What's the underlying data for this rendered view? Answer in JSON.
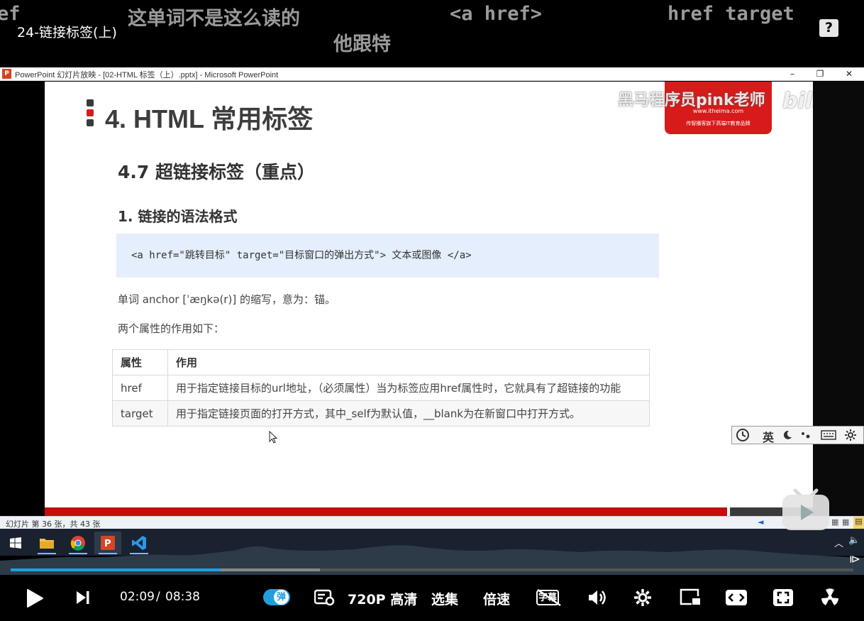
{
  "player": {
    "video_title": "24-链接标签(上)",
    "danmaku": [
      "ef",
      "这单词不是这么读的",
      "<a href>",
      "href target",
      "他跟特"
    ],
    "help_label": "?",
    "time_current": "02:09",
    "time_separator": "/",
    "time_total": "08:38",
    "danmaku_toggle_label": "弹",
    "quality_label": "720P 高清",
    "episodes_label": "选集",
    "speed_label": "倍速",
    "subtitle_label": "字幕",
    "progress_played": 0.249,
    "progress_buffered": 0.367,
    "accent_color": "#1f9fe0"
  },
  "ppt": {
    "window_title": "PowerPoint 幻灯片放映 - [02-HTML 标签（上）.pptx] - Microsoft PowerPoint",
    "icon_letter": "P",
    "status_slide_count": "幻灯片 第 36 张，共 43 张"
  },
  "slide": {
    "heading": "4. HTML 常用标签",
    "logo_url": "www.itheima.com",
    "logo_slogan": "传智播客旗下高端IT教育品牌",
    "watermark": "黑马程序员pink老师",
    "bili_logo": "bilibili",
    "sub_heading": "4.7 超链接标签（重点）",
    "section_heading": "1. 链接的语法格式",
    "code_line": "<a href=\"跳转目标\" target=\"目标窗口的弹出方式\"> 文本或图像 </a>",
    "anchor_text": "单词 anchor [ˈæŋkə(r)] 的缩写，意为：锚。",
    "attrs_text": "两个属性的作用如下：",
    "table": {
      "headers": [
        "属性",
        "作用"
      ],
      "rows": [
        [
          "href",
          "用于指定链接目标的url地址，（必须属性）当为标签应用href属性时，它就具有了超链接的功能"
        ],
        [
          "target",
          "用于指定链接页面的打开方式，其中_self为默认值，__blank为在新窗口中打开方式。"
        ]
      ]
    }
  },
  "ime": {
    "lang_label": "英",
    "items": [
      "clock-icon",
      "moon-icon",
      "punct-icon",
      "keyboard-icon",
      "gear-icon"
    ]
  },
  "taskbar": {
    "icons": [
      "windows-start-icon",
      "file-explorer-icon",
      "chrome-icon",
      "powerpoint-icon",
      "vscode-icon"
    ]
  }
}
